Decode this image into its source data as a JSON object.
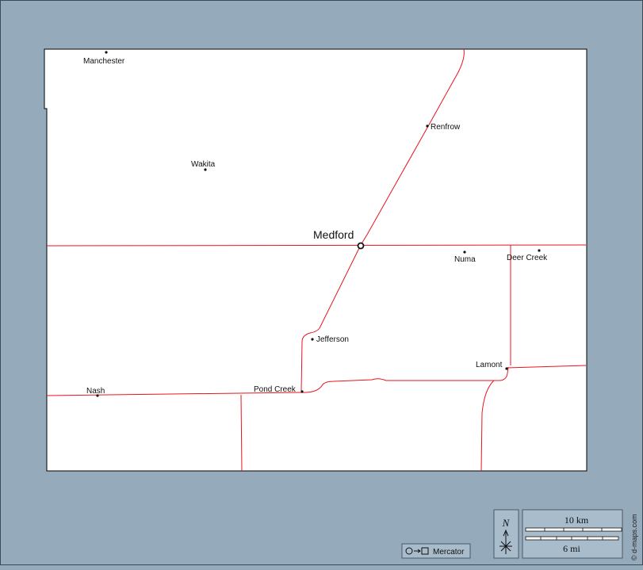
{
  "map": {
    "county_seat": {
      "name": "Medford"
    },
    "towns": [
      {
        "name": "Manchester"
      },
      {
        "name": "Renfrow"
      },
      {
        "name": "Wakita"
      },
      {
        "name": "Numa"
      },
      {
        "name": "Deer Creek"
      },
      {
        "name": "Jefferson"
      },
      {
        "name": "Lamont"
      },
      {
        "name": "Nash"
      },
      {
        "name": "Pond Creek"
      }
    ],
    "colors": {
      "background": "#95aabb",
      "county_fill": "#ffffff",
      "road": "#e8141c",
      "border": "#000000"
    }
  },
  "compass": {
    "label": "N"
  },
  "scale": {
    "km_label": "10 km",
    "mi_label": "6 mi"
  },
  "projection": {
    "label": "Mercator",
    "icon": "circle-to-square-icon"
  },
  "credit": "© d-maps.com"
}
